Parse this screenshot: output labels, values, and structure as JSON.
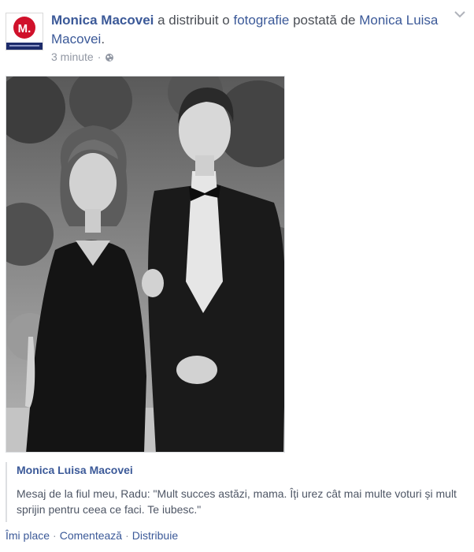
{
  "post": {
    "sharer_name": "Monica Macovei",
    "action_text": " a distribuit o ",
    "object_link": "fotografie",
    "posted_by_text": " postată de ",
    "original_author": "Monica Luisa Macovei",
    "period": ".",
    "timestamp": "3 minute",
    "meta_separator": "·",
    "privacy_icon": "globe-icon",
    "avatar_letter": "M."
  },
  "attachment": {
    "author": "Monica Luisa Macovei",
    "message": "Mesaj de la fiul meu, Radu: \"Mult succes astăzi, mama. Îți urez cât mai multe voturi și mult sprijin pentru ceea ce faci. Te iubesc.\""
  },
  "actions": {
    "like": "Îmi place",
    "comment": "Comentează",
    "share": "Distribuie",
    "separator": "·"
  },
  "colors": {
    "link": "#3b5998",
    "avatar_red": "#d0112b",
    "avatar_navy": "#1d2c6b"
  }
}
